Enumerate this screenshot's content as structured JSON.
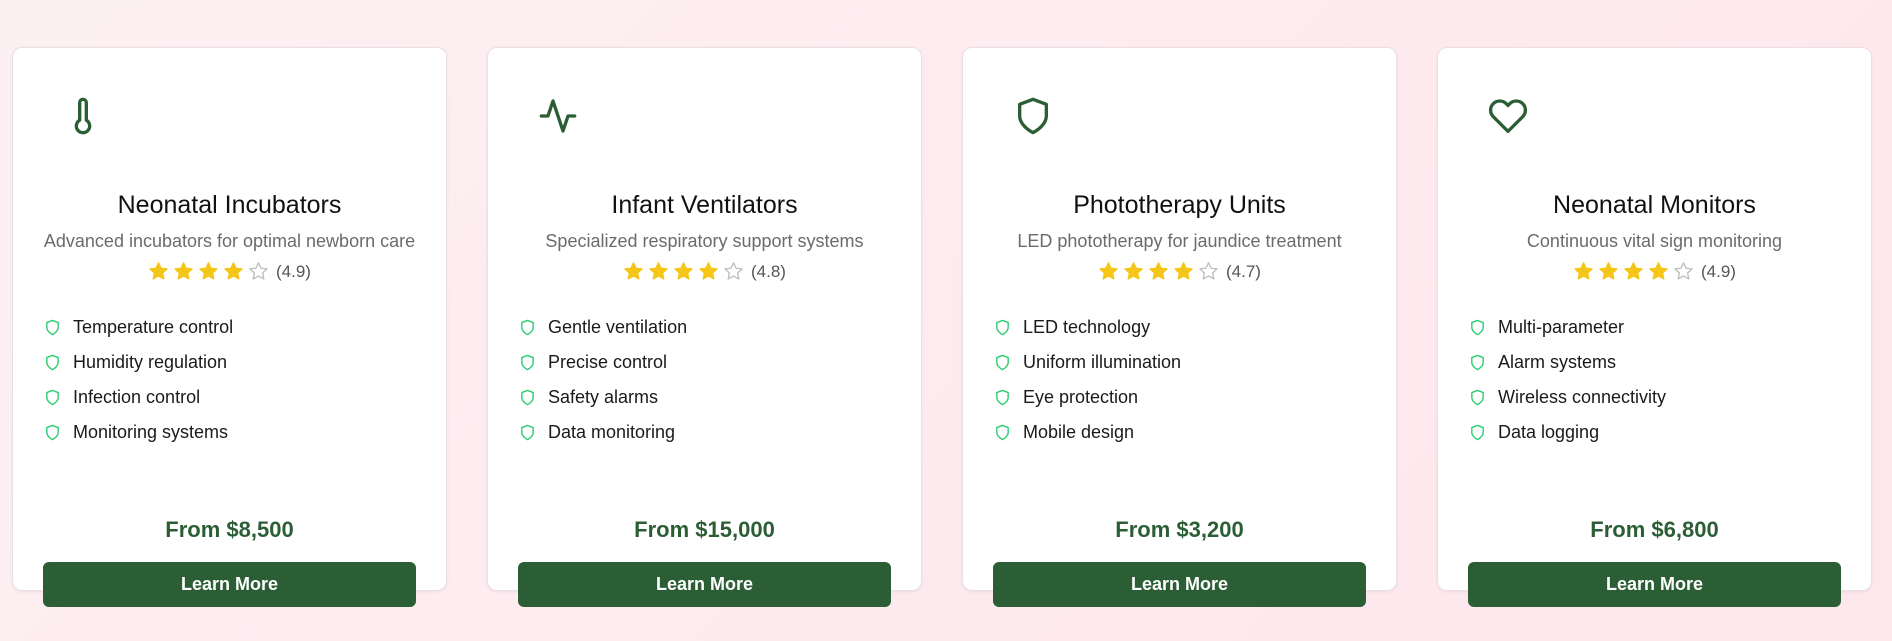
{
  "colors": {
    "accent": "#2c5e36",
    "star": "#f5c518",
    "star_empty": "#bdbdbd",
    "check": "#2ecc71"
  },
  "cards": [
    {
      "icon": "thermometer-icon",
      "title": "Neonatal Incubators",
      "description": "Advanced incubators for optimal newborn care",
      "stars_filled": 4,
      "stars_total": 5,
      "rating": "(4.9)",
      "features": [
        "Temperature control",
        "Humidity regulation",
        "Infection control",
        "Monitoring systems"
      ],
      "price": "From $8,500",
      "button": "Learn More"
    },
    {
      "icon": "activity-icon",
      "title": "Infant Ventilators",
      "description": "Specialized respiratory support systems",
      "stars_filled": 4,
      "stars_total": 5,
      "rating": "(4.8)",
      "features": [
        "Gentle ventilation",
        "Precise control",
        "Safety alarms",
        "Data monitoring"
      ],
      "price": "From $15,000",
      "button": "Learn More"
    },
    {
      "icon": "shield-icon",
      "title": "Phototherapy Units",
      "description": "LED phototherapy for jaundice treatment",
      "stars_filled": 4,
      "stars_total": 5,
      "rating": "(4.7)",
      "features": [
        "LED technology",
        "Uniform illumination",
        "Eye protection",
        "Mobile design"
      ],
      "price": "From $3,200",
      "button": "Learn More"
    },
    {
      "icon": "heart-icon",
      "title": "Neonatal Monitors",
      "description": "Continuous vital sign monitoring",
      "stars_filled": 4,
      "stars_total": 5,
      "rating": "(4.9)",
      "features": [
        "Multi-parameter",
        "Alarm systems",
        "Wireless connectivity",
        "Data logging"
      ],
      "price": "From $6,800",
      "button": "Learn More"
    }
  ]
}
